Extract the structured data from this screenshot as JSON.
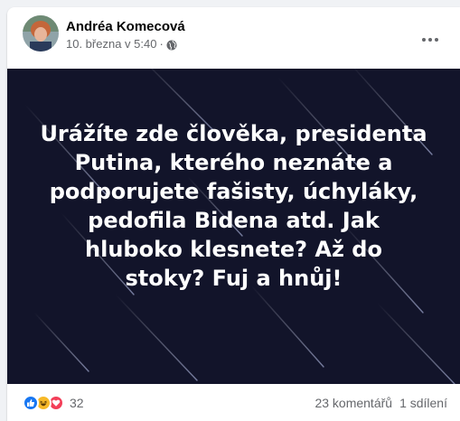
{
  "post": {
    "author": "Andréa Komecová",
    "timestamp": "10. března v 5:40",
    "separator": "·",
    "privacy_icon": "globe-icon",
    "more_icon": "more-options-icon",
    "image_text": "Urážíte zde člověka, presidenta\nPutina, kterého neznáte a\npodporujete fašisty, úchyláky,\npedofila Bidena atd. Jak\nhluboko klesnete? Až do\nstoky? Fuj a hnůj!",
    "image_background": "#12142a"
  },
  "reactions": {
    "icons": [
      "like-reaction-icon",
      "haha-reaction-icon",
      "love-reaction-icon"
    ],
    "count": "32"
  },
  "stats": {
    "comments": "23 komentářů",
    "shares": "1 sdílení"
  },
  "colors": {
    "like": "#1877f2",
    "love": "#f33e58",
    "haha": "#f7b928",
    "secondary_text": "#65676b"
  }
}
